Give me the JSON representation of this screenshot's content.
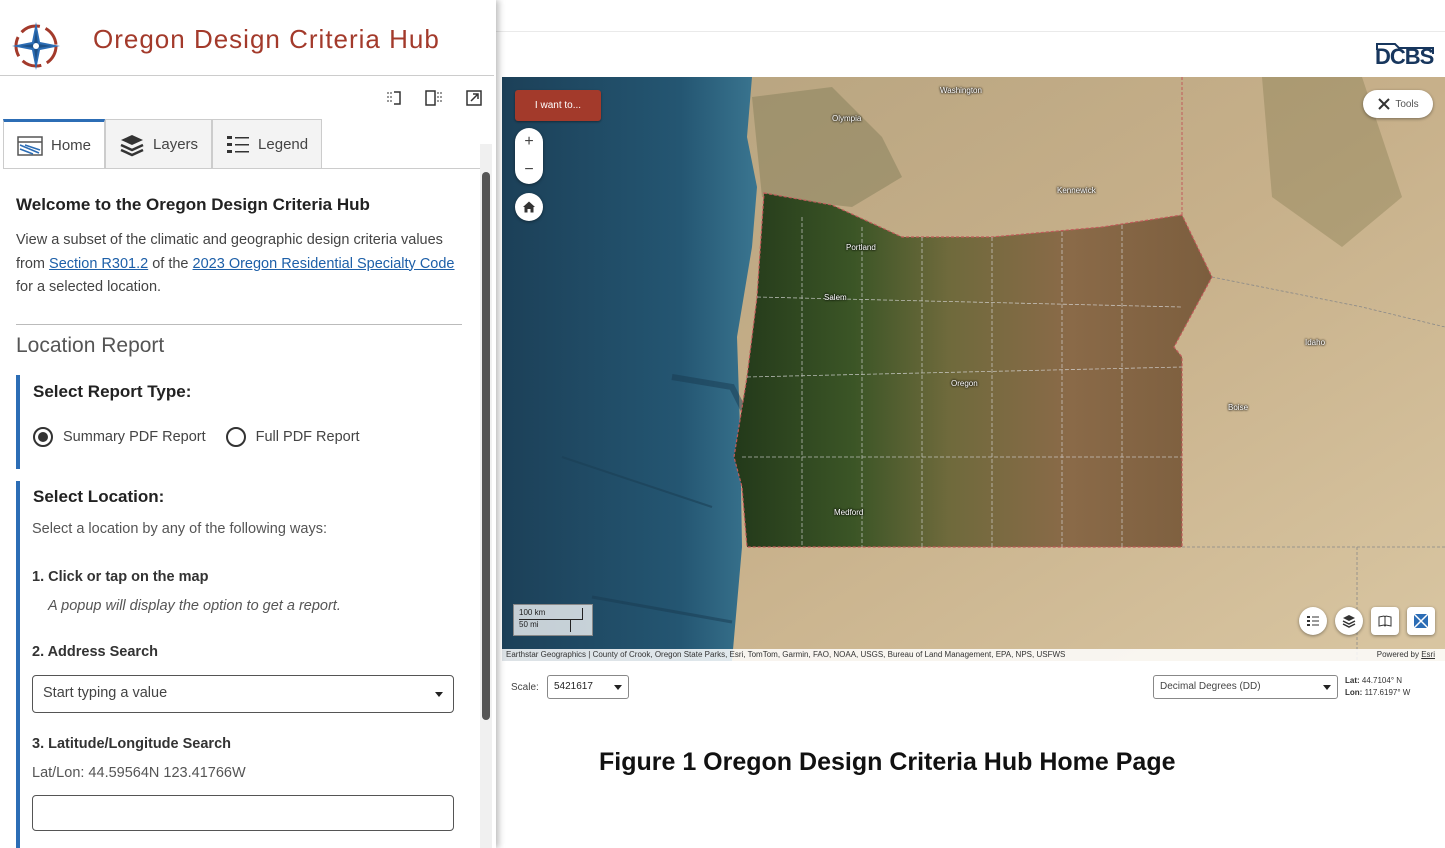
{
  "panel": {
    "title": "Oregon Design Criteria Hub",
    "tabs": [
      {
        "label": "Home",
        "icon": "home-map-icon",
        "active": true
      },
      {
        "label": "Layers",
        "icon": "layers-icon",
        "active": false
      },
      {
        "label": "Legend",
        "icon": "legend-icon",
        "active": false
      }
    ],
    "welcome": {
      "title": "Welcome to the Oregon Design Criteria Hub",
      "text_part1": "View a subset of the climatic and geographic design criteria values from ",
      "link1": "Section R301.2",
      "text_part2": " of the ",
      "link2": "2023 Oregon Residential Specialty Code",
      "text_part3": " for a selected location."
    },
    "location_report": "Location Report",
    "report_type": {
      "title": "Select Report Type:",
      "options": [
        {
          "label": "Summary PDF Report",
          "selected": true
        },
        {
          "label": "Full PDF Report",
          "selected": false
        }
      ]
    },
    "select_location": {
      "title": "Select Location:",
      "intro": "Select a location by any of the following ways:",
      "step1": "1. Click or tap on the map",
      "step1_hint": "A popup will display the option to get a report.",
      "step2": "2. Address Search",
      "address_placeholder": "Start typing a value",
      "step3": "3. Latitude/Longitude Search",
      "latlon_example": "Lat/Lon: 44.59564N 123.41766W",
      "latlon_value": ""
    }
  },
  "header": {
    "logo_text": "DCBS"
  },
  "map": {
    "iwant_label": "I want to...",
    "tools_label": "Tools",
    "labels": {
      "washington": "Washington",
      "olympia": "Olympia",
      "kennewick": "Kennewick",
      "portland": "Portland",
      "salem": "Salem",
      "oregon": "Oregon",
      "idaho": "Idaho",
      "boise": "Boise",
      "medford": "Medford"
    },
    "scalebar": {
      "km": "100 km",
      "mi": "50 mi"
    },
    "attribution": "Earthstar Geographics | County of Crook, Oregon State Parks, Esri, TomTom, Garmin, FAO, NOAA, USGS, Bureau of Land Management, EPA, NPS, USFWS",
    "powered_by": "Powered by ",
    "powered_by_link": "Esri"
  },
  "status": {
    "scale_label": "Scale:",
    "scale_value": "5421617",
    "coord_format": "Decimal Degrees (DD)",
    "lat_label": "Lat:",
    "lat_value": "44.7104° N",
    "lon_label": "Lon:",
    "lon_value": "117.6197° W"
  },
  "caption": "Figure 1 Oregon Design Criteria Hub Home Page",
  "colors": {
    "accent": "#2c6db5",
    "brand_red": "#a33a2b",
    "ocean": "#1f4a63",
    "forest": "#2f4a1e",
    "desert": "#b9976a"
  }
}
